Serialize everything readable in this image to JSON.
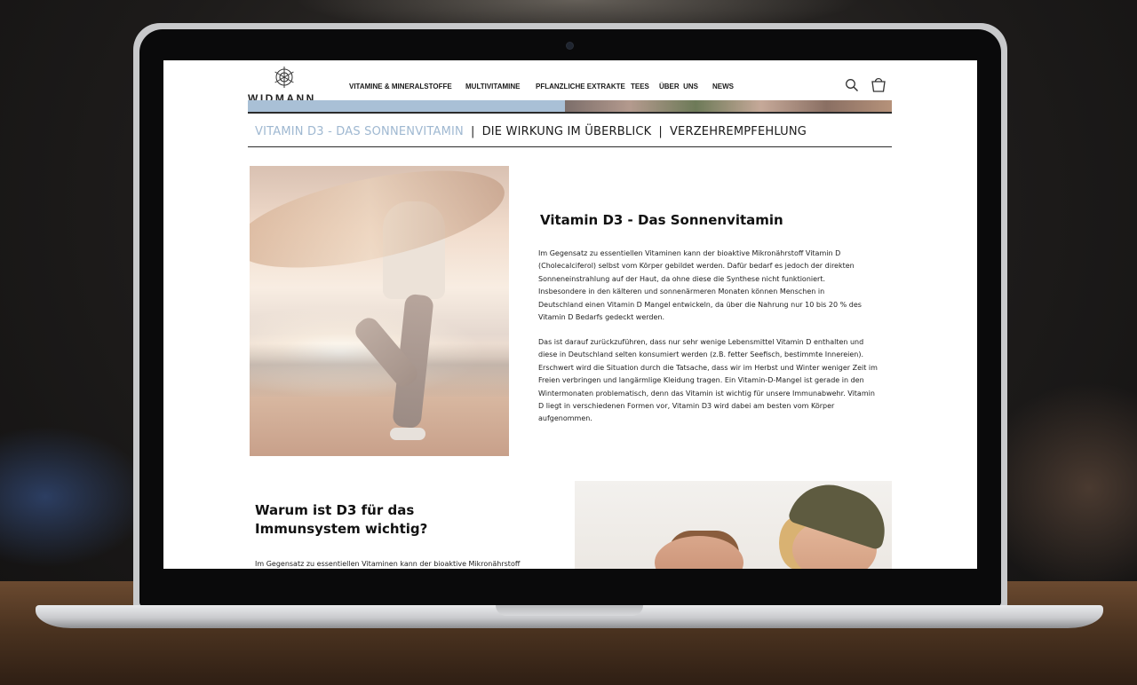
{
  "site": {
    "logo_text": "WIDMANN"
  },
  "nav": {
    "items": [
      {
        "label": "VITAMINE & MINERALSTOFFE"
      },
      {
        "label": "MULTIVITAMINE"
      },
      {
        "label": "PFLANZLICHE EXTRAKTE"
      },
      {
        "label": "TEES"
      },
      {
        "label": "ÜBER  UNS"
      },
      {
        "label": "NEWS"
      }
    ]
  },
  "subnav": {
    "items": [
      {
        "label": "VITAMIN D3 - DAS SONNENVITAMIN",
        "active": true
      },
      {
        "label": "DIE WIRKUNG IM ÜBERBLICK"
      },
      {
        "label": "VERZEHREMPFEHLUNG"
      }
    ],
    "separator": "|"
  },
  "section1": {
    "title": "Vitamin D3 - Das Sonnenvitamin",
    "paragraph1": "Im Gegensatz zu essentiellen Vitaminen kann der bioaktive Mikronährstoff Vitamin D (Cholecalciferol) selbst vom Körper gebildet werden. Dafür bedarf es jedoch der direkten Sonneneinstrahlung auf der Haut, da ohne diese die Synthese nicht funktioniert. Insbesondere in den kälteren und sonnenärmeren Monaten können Menschen in Deutschland einen Vitamin D Mangel entwickeln, da über die Nahrung nur 10 bis 20 % des Vitamin D Bedarfs gedeckt werden.",
    "paragraph2": "Das ist darauf zurückzuführen, dass nur sehr wenige Lebensmittel Vitamin D enthalten und diese in Deutschland  selten konsumiert werden (z.B. fetter Seefisch, bestimmte Innereien). Erschwert wird die Situation durch die Tatsache, dass wir im Herbst und Winter weniger Zeit im Freien verbringen und langärmlige Kleidung tragen. Ein Vitamin-D-Mangel ist gerade in den Wintermonaten problematisch, denn das Vitamin ist wichtig für unsere Immunabwehr. Vitamin D liegt in verschiedenen Formen vor, Vitamin D3 wird dabei am besten vom Körper aufgenommen."
  },
  "section2": {
    "title": "Warum ist D3 für das Immunsystem wichtig?",
    "paragraph_start": "Im Gegensatz zu essentiellen Vitaminen kann der bioaktive Mikronährstoff"
  },
  "colors": {
    "accent_light_blue": "#9fb8d1",
    "text": "#1a1a1a",
    "background": "#ffffff"
  },
  "icons": [
    "search-icon",
    "cart-icon",
    "logo-snowflake-icon"
  ]
}
